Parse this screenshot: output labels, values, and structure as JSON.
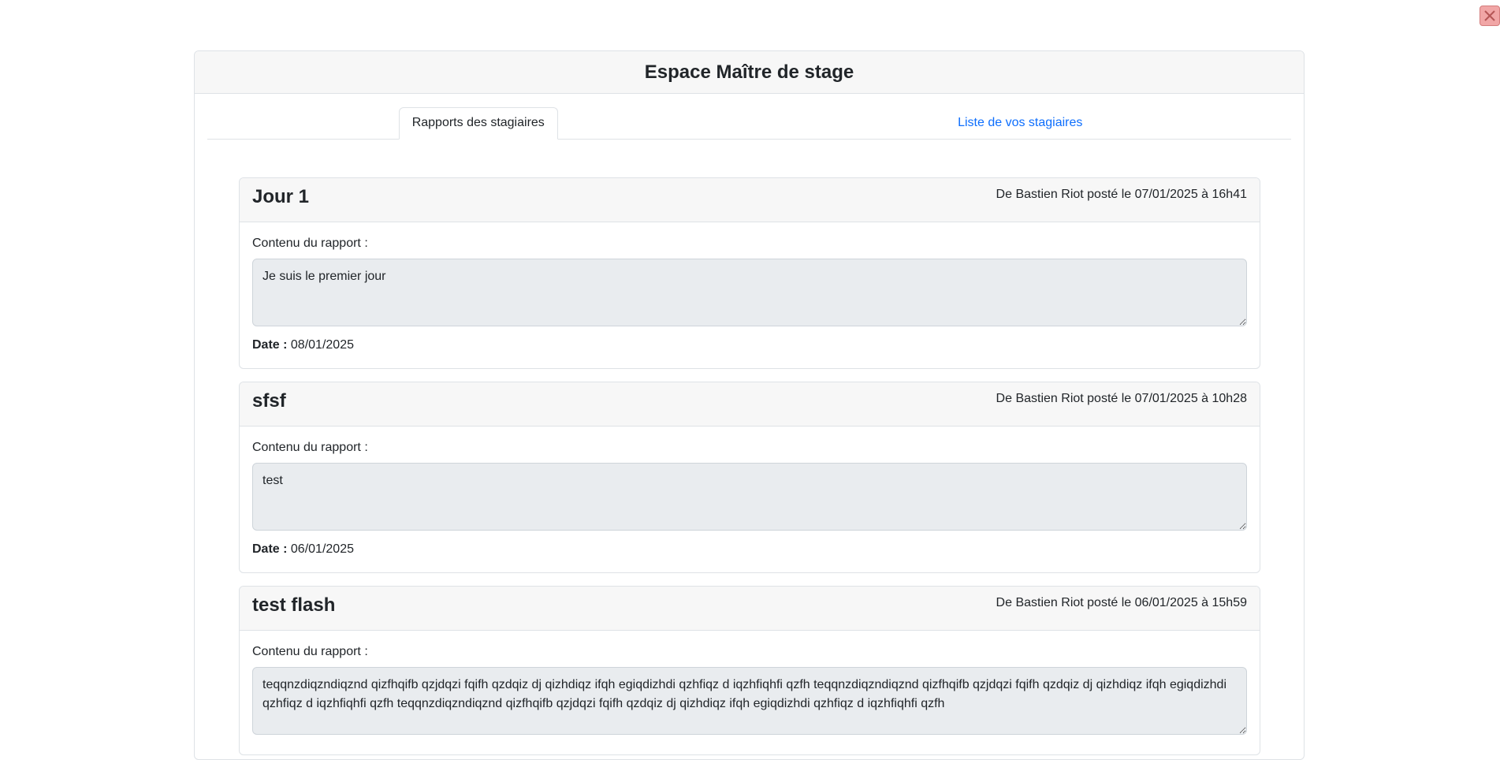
{
  "main": {
    "title": "Espace Maître de stage",
    "tabs": [
      {
        "label": "Rapports des stagiaires",
        "active": true
      },
      {
        "label": "Liste de vos stagiaires",
        "active": false
      }
    ]
  },
  "reports": [
    {
      "title": "Jour 1",
      "meta": "De Bastien Riot posté le 07/01/2025 à 16h41",
      "content_label": "Contenu du rapport :",
      "content": "Je suis le premier jour",
      "date_label": "Date :",
      "date": "08/01/2025"
    },
    {
      "title": "sfsf",
      "meta": "De Bastien Riot posté le 07/01/2025 à 10h28",
      "content_label": "Contenu du rapport :",
      "content": "test",
      "date_label": "Date :",
      "date": "06/01/2025"
    },
    {
      "title": "test flash",
      "meta": "De Bastien Riot posté le 06/01/2025 à 15h59",
      "content_label": "Contenu du rapport :",
      "content": "teqqnzdiqzndiqznd qizfhqifb qzjdqzi fqifh qzdqiz dj qizhdiqz ifqh egiqdizhdi qzhfiqz d iqzhfiqhfi qzfh teqqnzdiqzndiqznd qizfhqifb qzjdqzi fqifh qzdqiz dj qizhdiqz ifqh egiqdizhdi qzhfiqz d iqzhfiqhfi qzfh teqqnzdiqzndiqznd qizfhqifb qzjdqzi fqifh qzdqiz dj qizhdiqz ifqh egiqdizhdi qzhfiqz d iqzhfiqhfi qzfh"
    }
  ],
  "colors": {
    "link": "#0d6efd",
    "header_bg": "#f7f7f7",
    "textarea_bg": "#e9ecef",
    "close_bg": "#f1a6a6"
  },
  "icons": {
    "close": "close-icon"
  }
}
